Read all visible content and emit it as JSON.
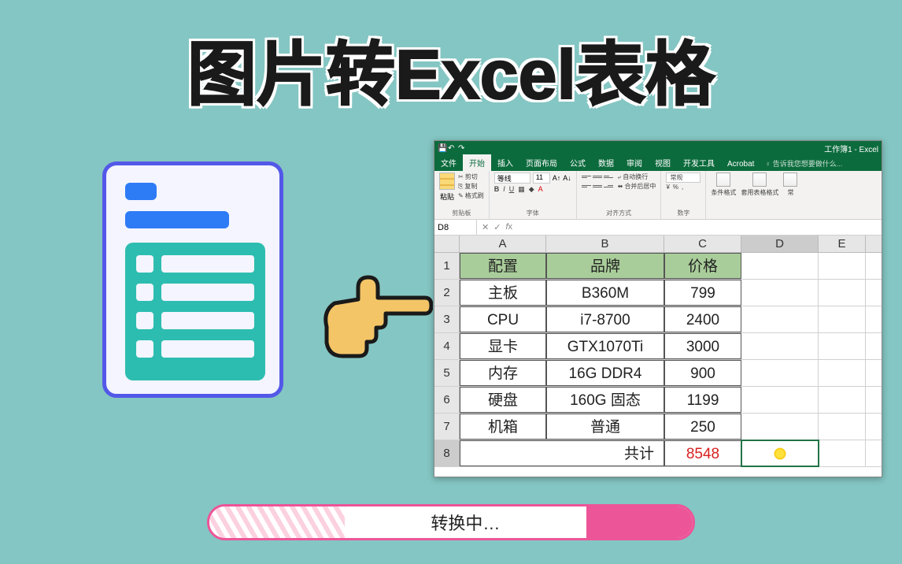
{
  "title": "图片转Excel表格",
  "excel": {
    "window_title": "工作簿1 - Excel",
    "tabs": {
      "file": "文件",
      "home": "开始",
      "insert": "插入",
      "layout": "页面布局",
      "formulas": "公式",
      "data": "数据",
      "review": "审阅",
      "view": "视图",
      "dev": "开发工具",
      "acrobat": "Acrobat",
      "tell_me": "告诉我您想要做什么..."
    },
    "ribbon": {
      "paste": "粘贴",
      "cut": "剪切",
      "copy": "复制",
      "format_painter": "格式刷",
      "clipboard_label": "剪贴板",
      "font_name": "等线",
      "font_size": "11",
      "font_label": "字体",
      "wrap": "自动换行",
      "merge": "合并后居中",
      "align_label": "对齐方式",
      "number_format": "常规",
      "number_label": "数字",
      "cond_format": "条件格式",
      "table_format": "套用表格格式",
      "styles_extra": "常"
    },
    "namebox": "D8",
    "columns": [
      "A",
      "B",
      "C",
      "D",
      "E"
    ],
    "headers": {
      "a": "配置",
      "b": "品牌",
      "c": "价格"
    },
    "rows": [
      {
        "n": "2",
        "a": "主板",
        "b": "B360M",
        "c": "799"
      },
      {
        "n": "3",
        "a": "CPU",
        "b": "i7-8700",
        "c": "2400"
      },
      {
        "n": "4",
        "a": "显卡",
        "b": "GTX1070Ti",
        "c": "3000"
      },
      {
        "n": "5",
        "a": "内存",
        "b": "16G DDR4",
        "c": "900"
      },
      {
        "n": "6",
        "a": "硬盘",
        "b": "160G 固态",
        "c": "1199"
      },
      {
        "n": "7",
        "a": "机箱",
        "b": "普通",
        "c": "250"
      }
    ],
    "total_row": {
      "n": "8",
      "label": "共计",
      "value": "8548"
    }
  },
  "progress_label": "转换中…"
}
